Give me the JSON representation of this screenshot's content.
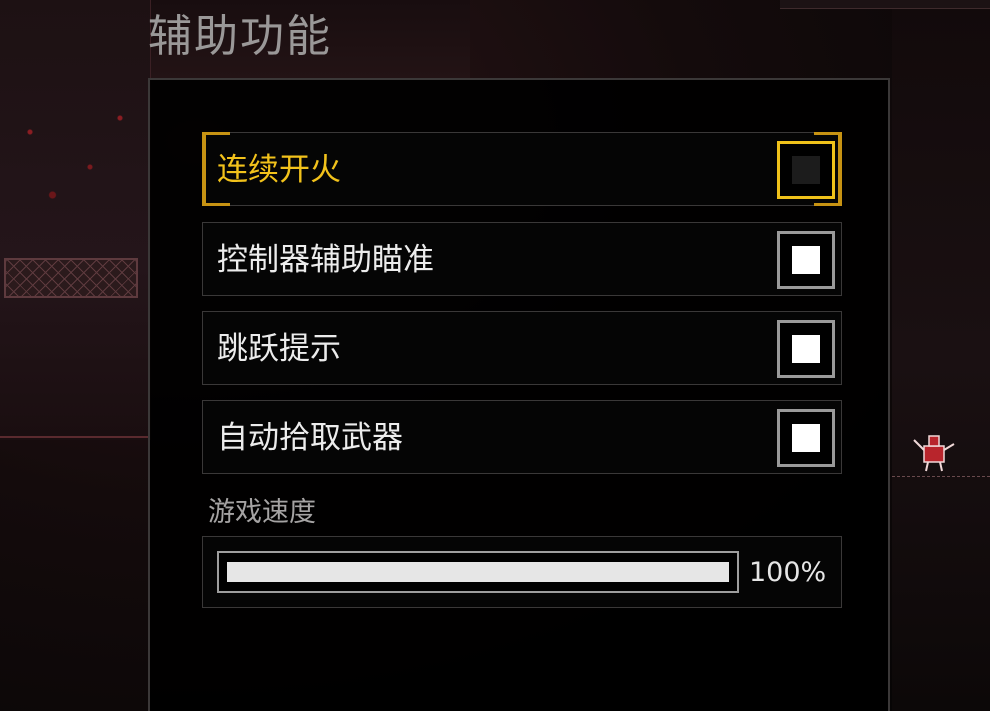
{
  "header": {
    "title": "辅助功能"
  },
  "settings": [
    {
      "label": "连续开火",
      "checked": false,
      "selected": true
    },
    {
      "label": "控制器辅助瞄准",
      "checked": true,
      "selected": false
    },
    {
      "label": "跳跃提示",
      "checked": true,
      "selected": false
    },
    {
      "label": "自动拾取武器",
      "checked": true,
      "selected": false
    }
  ],
  "game_speed": {
    "label": "游戏速度",
    "value_text": "100%",
    "value": 1.0
  },
  "colors": {
    "accent": "#f2c21b",
    "bracket": "#c79313",
    "text": "#ececec",
    "border": "#3a3838"
  }
}
